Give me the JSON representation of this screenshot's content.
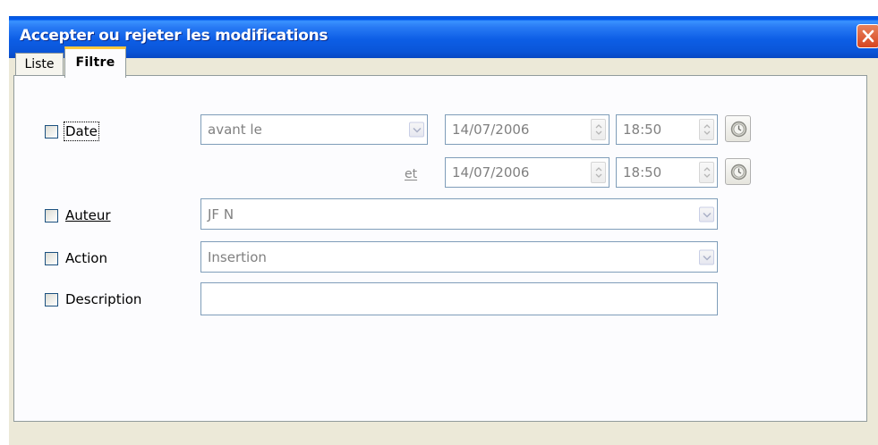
{
  "window": {
    "title": "Accepter ou rejeter les modifications"
  },
  "tabs": [
    {
      "label": "Liste",
      "selected": false
    },
    {
      "label": "Filtre",
      "selected": true
    }
  ],
  "filters": {
    "date": {
      "label": "Date",
      "checked": false,
      "condition": "avant le",
      "date1": "14/07/2006",
      "time1": "18:50",
      "and_label": "et",
      "date2": "14/07/2006",
      "time2": "18:50"
    },
    "author": {
      "label": "Auteur",
      "checked": false,
      "value": "JF N"
    },
    "action": {
      "label": "Action",
      "checked": false,
      "value": "Insertion"
    },
    "description": {
      "label": "Description",
      "checked": false,
      "value": ""
    }
  },
  "colors": {
    "titlebar": "#0a55d8",
    "close": "#d64520",
    "tab_highlight": "#ffc83c",
    "field_border": "#7f9db9",
    "dialog_bg": "#ece9d8"
  },
  "icons": {
    "close": "close-icon",
    "dropdown": "chevron-down-icon",
    "spin": "spin-up-down-icon",
    "clock": "clock-icon"
  }
}
